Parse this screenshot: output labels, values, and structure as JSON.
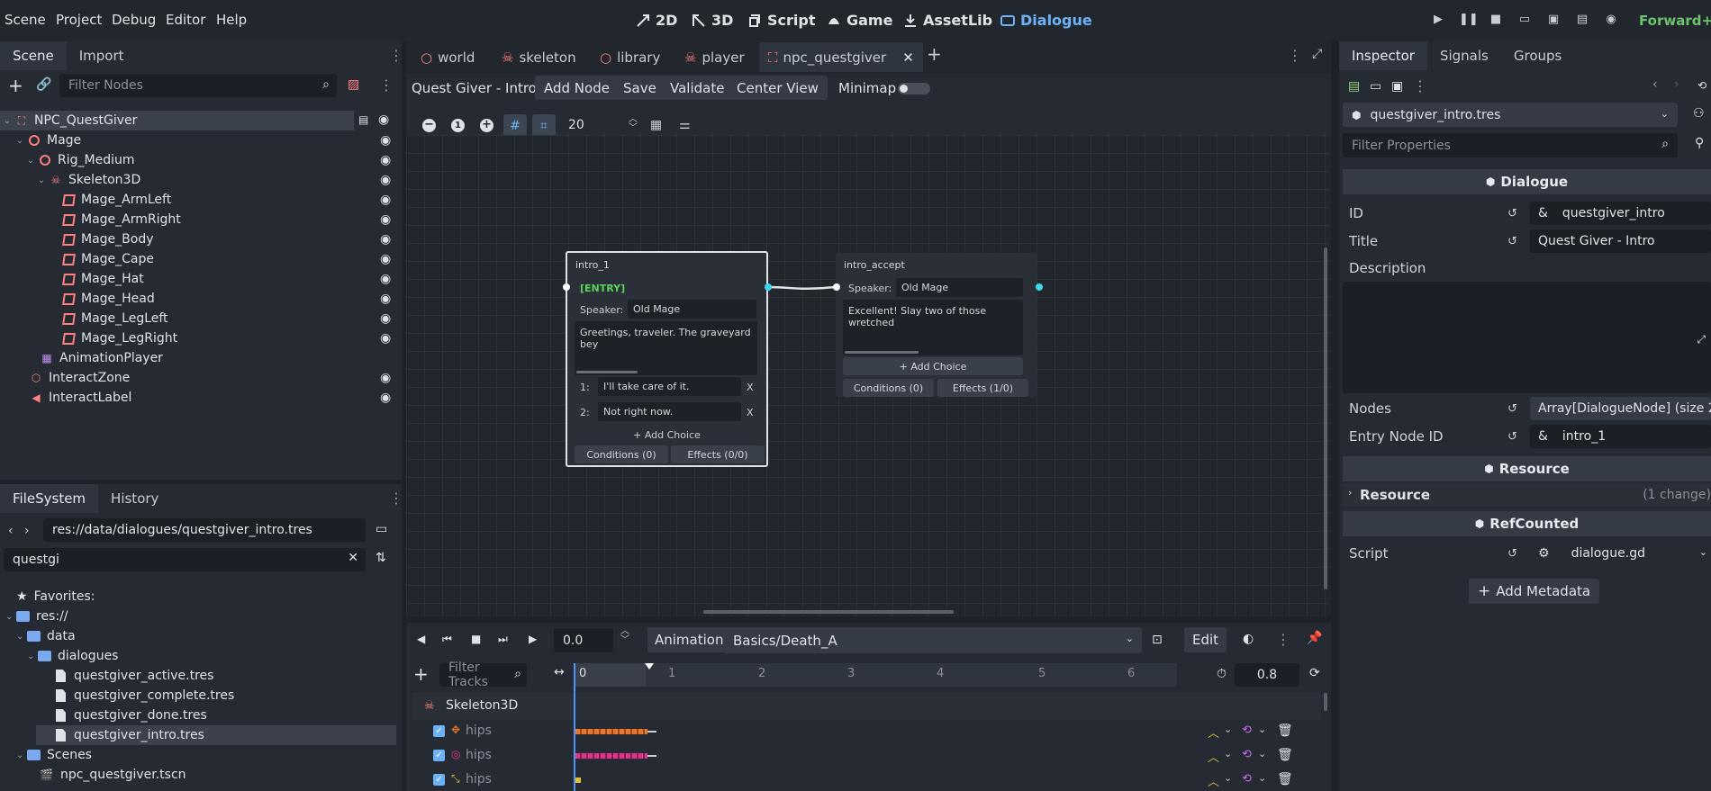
{
  "menu": [
    "Scene",
    "Project",
    "Debug",
    "Editor",
    "Help"
  ],
  "workspaces": [
    {
      "label": "2D",
      "icon": "2d-icon"
    },
    {
      "label": "3D",
      "icon": "3d-icon"
    },
    {
      "label": "Script",
      "icon": "script-icon"
    },
    {
      "label": "Game",
      "icon": "game-icon"
    },
    {
      "label": "AssetLib",
      "icon": "assetlib-icon"
    },
    {
      "label": "Dialogue",
      "icon": "dialogue-icon"
    }
  ],
  "renderer_label": "Forward+",
  "scene_dock": {
    "tabs": [
      "Scene",
      "Import"
    ],
    "filter_placeholder": "Filter Nodes",
    "tree": [
      {
        "label": "NPC_QuestGiver",
        "icon": "root"
      },
      {
        "label": "Mage",
        "icon": "circle"
      },
      {
        "label": "Rig_Medium",
        "icon": "circle"
      },
      {
        "label": "Skeleton3D",
        "icon": "skeleton"
      },
      {
        "label": "Mage_ArmLeft",
        "icon": "mesh"
      },
      {
        "label": "Mage_ArmRight",
        "icon": "mesh"
      },
      {
        "label": "Mage_Body",
        "icon": "mesh"
      },
      {
        "label": "Mage_Cape",
        "icon": "mesh"
      },
      {
        "label": "Mage_Hat",
        "icon": "mesh"
      },
      {
        "label": "Mage_Head",
        "icon": "mesh"
      },
      {
        "label": "Mage_LegLeft",
        "icon": "mesh"
      },
      {
        "label": "Mage_LegRight",
        "icon": "mesh"
      },
      {
        "label": "AnimationPlayer",
        "icon": "anim"
      },
      {
        "label": "InteractZone",
        "icon": "area"
      },
      {
        "label": "InteractLabel",
        "icon": "label"
      }
    ]
  },
  "filesystem_dock": {
    "tabs": [
      "FileSystem",
      "History"
    ],
    "path": "res://data/dialogues/questgiver_intro.tres",
    "search": "questgi",
    "favorites": "Favorites:",
    "tree": [
      {
        "label": "res://",
        "type": "folder"
      },
      {
        "label": "data",
        "type": "folder"
      },
      {
        "label": "dialogues",
        "type": "folder"
      },
      {
        "label": "questgiver_active.tres",
        "type": "file"
      },
      {
        "label": "questgiver_complete.tres",
        "type": "file"
      },
      {
        "label": "questgiver_done.tres",
        "type": "file"
      },
      {
        "label": "questgiver_intro.tres",
        "type": "file"
      },
      {
        "label": "Scenes",
        "type": "folder"
      },
      {
        "label": "npc_questgiver.tscn",
        "type": "scene"
      }
    ]
  },
  "editor_tabs": [
    "world",
    "skeleton",
    "library",
    "player",
    "npc_questgiver"
  ],
  "dialogue_toolbar": {
    "name": "Quest Giver - Intro",
    "add_node": "Add Node",
    "save": "Save",
    "validate": "Validate",
    "center_view": "Center View",
    "minimap": "Minimap"
  },
  "graph_toolbar": {
    "snap_value": "20"
  },
  "nodes": {
    "intro_1": {
      "title": "intro_1",
      "entry": "[ENTRY]",
      "speaker_label": "Speaker:",
      "speaker": "Old Mage",
      "text": "Greetings, traveler. The graveyard bey",
      "choices": [
        {
          "num": "1:",
          "text": "I'll take care of it.",
          "x": "X"
        },
        {
          "num": "2:",
          "text": "Not right now.",
          "x": "X"
        }
      ],
      "add_choice": "+ Add Choice",
      "conditions": "Conditions (0)",
      "effects": "Effects (0/0)"
    },
    "intro_accept": {
      "title": "intro_accept",
      "speaker_label": "Speaker:",
      "speaker": "Old Mage",
      "text": "Excellent! Slay two of those wretched",
      "add_choice": "+ Add Choice",
      "conditions": "Conditions (0)",
      "effects": "Effects (1/0)"
    }
  },
  "animation": {
    "time": "0.0",
    "animation_label": "Animation",
    "current": "Basics/Death_A",
    "edit": "Edit",
    "filter_placeholder": "Filter Tracks",
    "ruler": [
      "0",
      "1",
      "2",
      "3",
      "4",
      "5",
      "6"
    ],
    "length": "0.8",
    "group": "Skeleton3D",
    "tracks": [
      {
        "label": "hips",
        "color": "#e8762d"
      },
      {
        "label": "hips",
        "color": "#e0358a"
      },
      {
        "label": "hips",
        "color": "#e0c030"
      }
    ]
  },
  "inspector": {
    "tabs": [
      "Inspector",
      "Signals",
      "Groups"
    ],
    "resource": "questgiver_intro.tres",
    "filter_placeholder": "Filter Properties",
    "section_dialogue": "Dialogue",
    "props": {
      "id_label": "ID",
      "id_value": "questgiver_intro",
      "title_label": "Title",
      "title_value": "Quest Giver - Intro",
      "description_label": "Description",
      "nodes_label": "Nodes",
      "nodes_value": "Array[DialogueNode] (size 2",
      "entry_label": "Entry Node ID",
      "entry_value": "intro_1"
    },
    "section_resource": "Resource",
    "resource_group": "Resource",
    "resource_change": "(1 change)",
    "section_refcounted": "RefCounted",
    "script_label": "Script",
    "script_value": "dialogue.gd",
    "add_metadata": "Add Metadata",
    "amp": "&"
  }
}
